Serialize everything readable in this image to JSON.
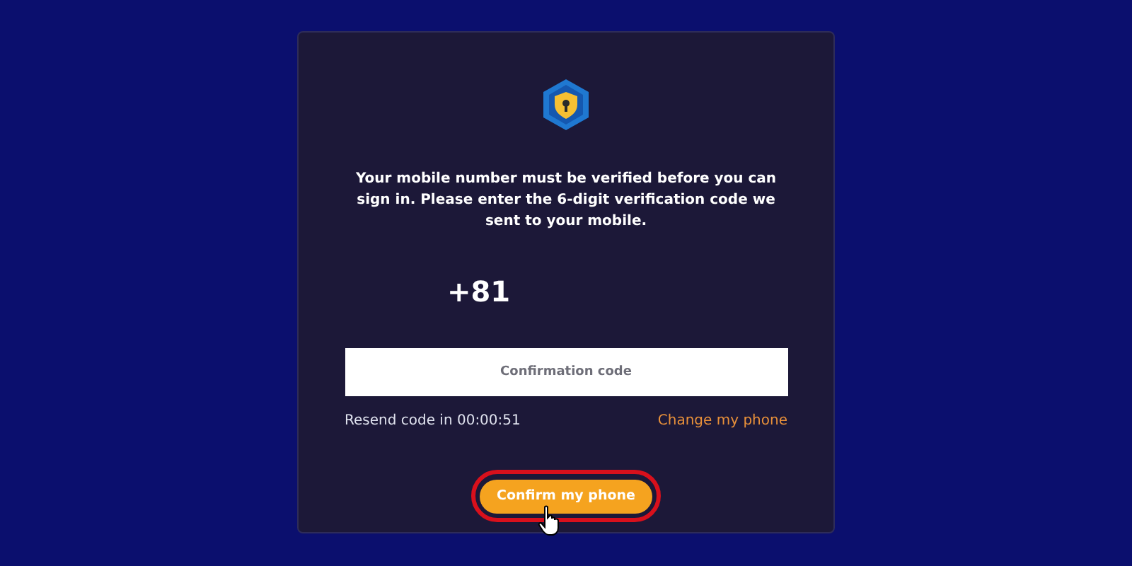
{
  "message": "Your mobile number must be verified before you can sign in. Please enter the 6-digit verification code we sent to your mobile.",
  "country_code": "+81",
  "code_field": {
    "placeholder": "Confirmation code"
  },
  "resend_timer": "Resend code in 00:00:51",
  "change_phone_link": "Change my phone",
  "confirm_button": {
    "label": "Confirm my phone",
    "highlighted": true
  }
}
